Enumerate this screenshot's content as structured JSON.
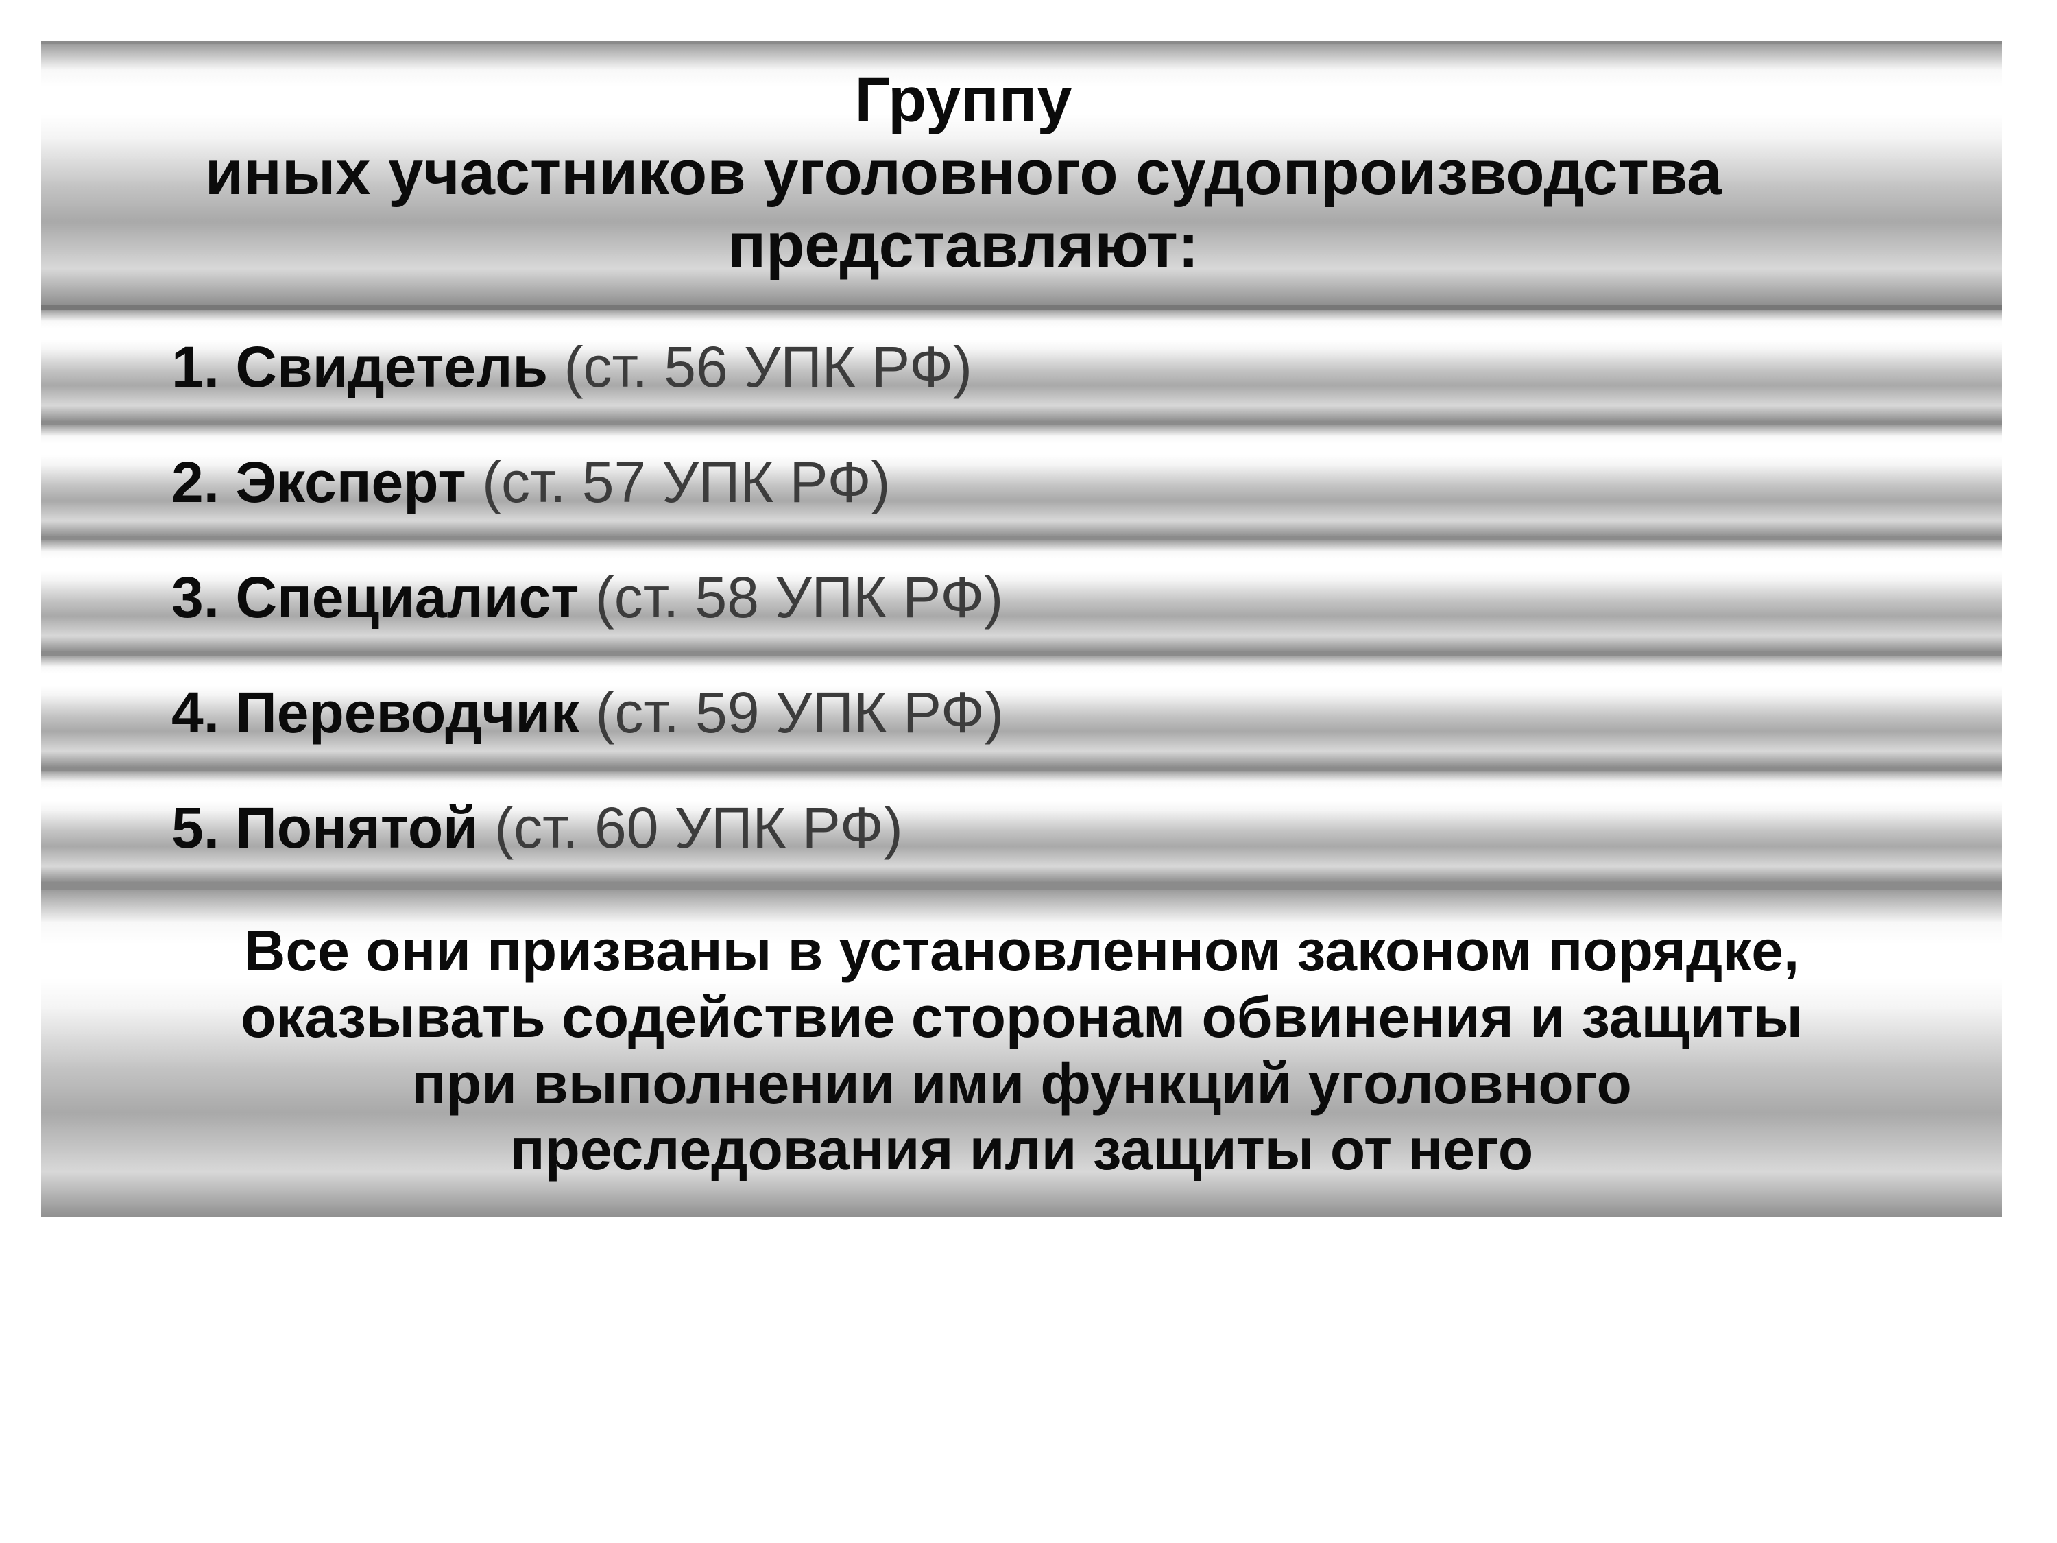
{
  "header": {
    "line1": "Группу",
    "line2": "иных участников уголовного судопроизводства",
    "line3": "представляют:"
  },
  "items": [
    {
      "num": "1.",
      "name": "Свидетель",
      "cite": "(ст. 56 УПК РФ)"
    },
    {
      "num": "2.",
      "name": "Эксперт",
      "cite": "(ст. 57 УПК РФ)"
    },
    {
      "num": "3.",
      "name": "Специалист",
      "cite": "(ст. 58 УПК РФ)"
    },
    {
      "num": "4.",
      "name": "Переводчик",
      "cite": "(ст. 59 УПК РФ)"
    },
    {
      "num": "5.",
      "name": "Понятой",
      "cite": "(ст. 60 УПК РФ)"
    }
  ],
  "footer": {
    "line1": "Все они призваны в установленном законом порядке,",
    "line2": "оказывать содействие сторонам обвинения и защиты",
    "line3": "при выполнении ими функций уголовного",
    "line4": "преследования или защиты от него"
  }
}
